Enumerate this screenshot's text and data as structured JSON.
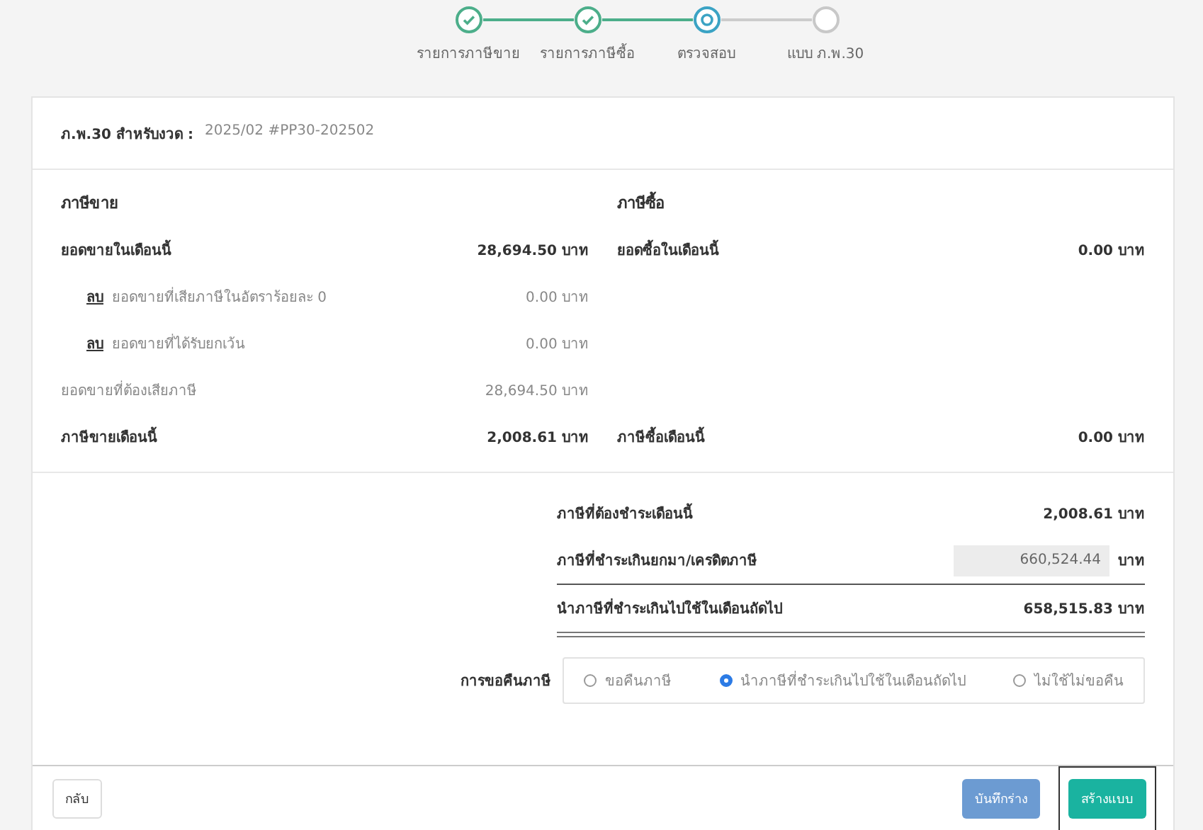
{
  "steps": [
    {
      "label": "รายการภาษีขาย",
      "done": true,
      "current": false
    },
    {
      "label": "รายการภาษีซื้อ",
      "done": true,
      "current": false
    },
    {
      "label": "ตรวจสอบ",
      "done": false,
      "current": true
    },
    {
      "label": "แบบ ภ.พ.30",
      "done": false,
      "current": false
    }
  ],
  "period": {
    "label": "ภ.พ.30 สำหรับงวด :",
    "value": "2025/02 #PP30-202502"
  },
  "sales": {
    "title": "ภาษีขาย",
    "rows": [
      {
        "kind": "main",
        "label": "ยอดขายในเดือนนี้",
        "value": "28,694.50 บาท"
      },
      {
        "kind": "deduct",
        "tag": "ลบ",
        "label": "ยอดขายที่เสียภาษีในอัตราร้อยละ 0",
        "value": "0.00 บาท"
      },
      {
        "kind": "deduct",
        "tag": "ลบ",
        "label": "ยอดขายที่ได้รับยกเว้น",
        "value": "0.00 บาท"
      },
      {
        "kind": "sub",
        "label": "ยอดขายที่ต้องเสียภาษี",
        "value": "28,694.50 บาท"
      },
      {
        "kind": "main",
        "label": "ภาษีขายเดือนนี้",
        "value": "2,008.61 บาท"
      }
    ]
  },
  "purchases": {
    "title": "ภาษีซื้อ",
    "rows": [
      {
        "kind": "main",
        "label": "ยอดซื้อในเดือนนี้",
        "value": "0.00 บาท"
      },
      {
        "kind": "blank"
      },
      {
        "kind": "blank"
      },
      {
        "kind": "blank"
      },
      {
        "kind": "main",
        "label": "ภาษีซื้อเดือนนี้",
        "value": "0.00 บาท"
      }
    ]
  },
  "summary": [
    {
      "kind": "text",
      "label": "ภาษีที่ต้องชำระเดือนนี้",
      "value": "2,008.61 บาท"
    },
    {
      "kind": "input",
      "label": "ภาษีที่ชำระเกินยกมา/เครดิตภาษี",
      "value": "660,524.44",
      "unit": "บาท"
    },
    {
      "kind": "total",
      "label": "นำภาษีที่ชำระเกินไปใช้ในเดือนถัดไป",
      "value": "658,515.83 บาท"
    }
  ],
  "refund": {
    "label": "การขอคืนภาษี",
    "options": [
      {
        "label": "ขอคืนภาษี",
        "selected": false
      },
      {
        "label": "นำภาษีที่ชำระเกินไปใช้ในเดือนถัดไป",
        "selected": true
      },
      {
        "label": "ไม่ใช้ไม่ขอคืน",
        "selected": false
      }
    ]
  },
  "footer": {
    "back": "กลับ",
    "buttons": [
      {
        "kind": "draft",
        "label": "บันทึกร่าง",
        "focused": false
      },
      {
        "kind": "create",
        "label": "สร้างแบบ",
        "focused": true
      }
    ]
  }
}
